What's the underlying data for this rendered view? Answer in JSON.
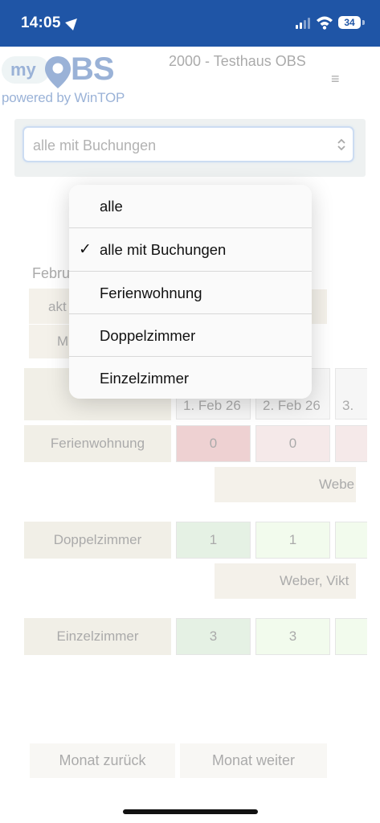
{
  "status_bar": {
    "time": "14:05",
    "battery": "34"
  },
  "app": {
    "logo_my": "my",
    "logo_name_suffix": "BS",
    "logo_subtitle": "powered by WinTOP",
    "hotel_title": "2000 - Testhaus OBS",
    "menu_icon": "≡"
  },
  "filter": {
    "selected": "alle mit Buchungen",
    "options": [
      {
        "label": "alle",
        "checked": false
      },
      {
        "label": "alle mit Buchungen",
        "checked": true
      },
      {
        "label": "Ferienwohnung",
        "checked": false
      },
      {
        "label": "Doppelzimmer",
        "checked": false
      },
      {
        "label": "Einzelzimmer",
        "checked": false
      }
    ],
    "check_mark": "✓"
  },
  "calendar": {
    "month_label_partial": "Febru",
    "aktuell_partial": "akt",
    "m_partial": "M",
    "dates": [
      "1. Feb 26",
      "2. Feb 26",
      "3."
    ],
    "rooms": [
      {
        "name": "Ferienwohnung",
        "counts": [
          "0",
          "0",
          ""
        ],
        "booking": "Webe",
        "status_color": "#e8cfcf",
        "first_color": "#d9999b"
      },
      {
        "name": "Doppelzimmer",
        "counts": [
          "1",
          "1",
          ""
        ],
        "booking": "Weber, Vikt",
        "status_color": "#e3f5d8",
        "first_color": "#c6dfc4"
      },
      {
        "name": "Einzelzimmer",
        "counts": [
          "3",
          "3",
          ""
        ],
        "booking": "",
        "status_color": "#e3f5d8",
        "first_color": "#c6dfc4"
      }
    ]
  },
  "navigation": {
    "prev": "Monat zurück",
    "next": "Monat weiter"
  }
}
